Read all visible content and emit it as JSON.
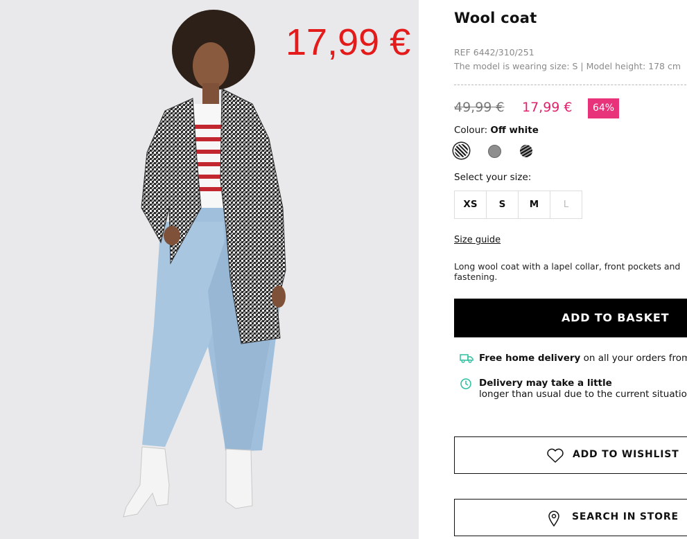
{
  "product": {
    "overlay_price": "17,99 €",
    "title": "Wool coat",
    "ref": "REF 6442/310/251",
    "model_info": "The model is wearing size: S | Model height: 178 cm",
    "old_price": "49,99 €",
    "new_price": "17,99 €",
    "discount": "64%",
    "colour_label": "Colour:",
    "colour_value": "Off white",
    "swatch_names": [
      "off-white-houndstooth",
      "grey",
      "black-stripe"
    ],
    "size_label": "Select your size:",
    "sizes": [
      "XS",
      "S",
      "M",
      "L"
    ],
    "size_guide": "Size guide",
    "description": "Long wool coat with a lapel collar, front pockets and fastening.",
    "add_to_basket": "ADD TO BASKET",
    "delivery_bold": "Free home delivery",
    "delivery_rest": " on all your orders from €",
    "delay_line1": "Delivery may take a little",
    "delay_line2": "longer than usual due to the current situatio",
    "wishlist": "ADD TO WISHLIST",
    "search_store": "SEARCH IN STORE"
  },
  "colors": {
    "overlay_red": "#e31b1b",
    "sale_pink": "#e2216c",
    "badge_pink": "#e8337a",
    "accent_teal": "#2bbfa0"
  }
}
